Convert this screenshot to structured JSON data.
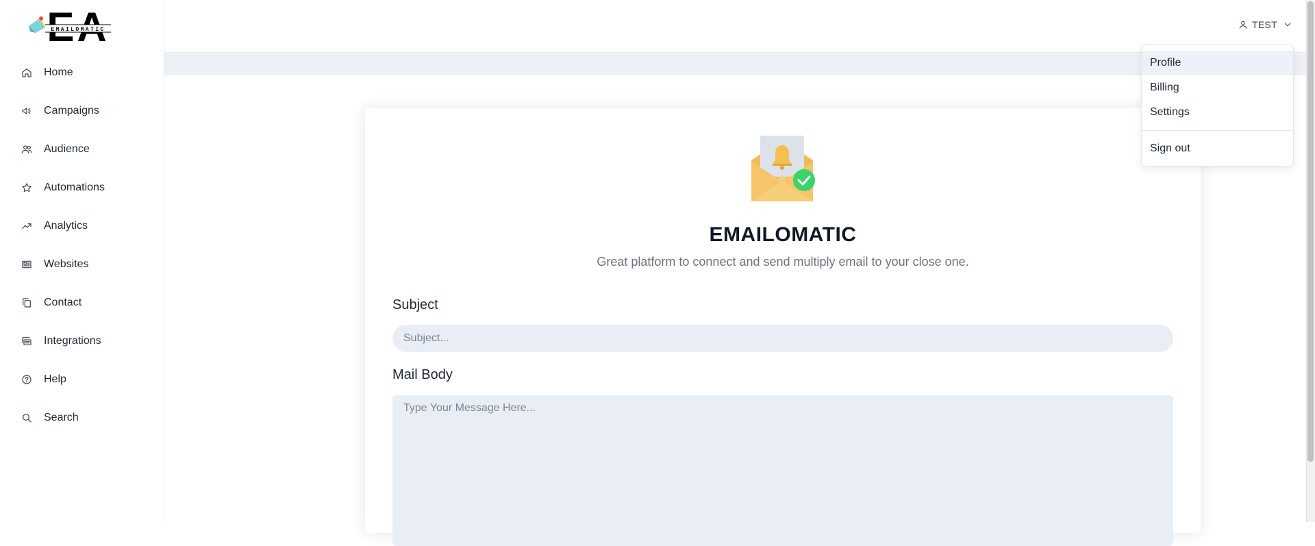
{
  "brand": {
    "logo_text": "EA",
    "logo_subtext": "EMAILOMATIC",
    "name": "EMAILOMATIC",
    "tagline": "Great platform to connect and send multiply email to your close one."
  },
  "sidebar": {
    "items": [
      {
        "label": "Home",
        "icon": "home-icon"
      },
      {
        "label": "Campaigns",
        "icon": "megaphone-icon"
      },
      {
        "label": "Audience",
        "icon": "users-icon"
      },
      {
        "label": "Automations",
        "icon": "star-icon"
      },
      {
        "label": "Analytics",
        "icon": "trending-up-icon"
      },
      {
        "label": "Websites",
        "icon": "newspaper-icon"
      },
      {
        "label": "Contact",
        "icon": "copy-icon"
      },
      {
        "label": "Integrations",
        "icon": "stack-icon"
      },
      {
        "label": "Help",
        "icon": "help-circle-icon"
      },
      {
        "label": "Search",
        "icon": "search-icon"
      }
    ]
  },
  "header": {
    "user_name": "TEST"
  },
  "user_menu": {
    "items": [
      "Profile",
      "Billing",
      "Settings"
    ],
    "signout": "Sign out"
  },
  "form": {
    "subject_label": "Subject",
    "subject_placeholder": "Subject...",
    "body_label": "Mail Body",
    "body_placeholder": "Type Your Message Here..."
  },
  "colors": {
    "accent_bg": "#edf1f7",
    "input_bg": "#e9eef6",
    "text": "#1f2937",
    "muted": "#6b7280"
  }
}
